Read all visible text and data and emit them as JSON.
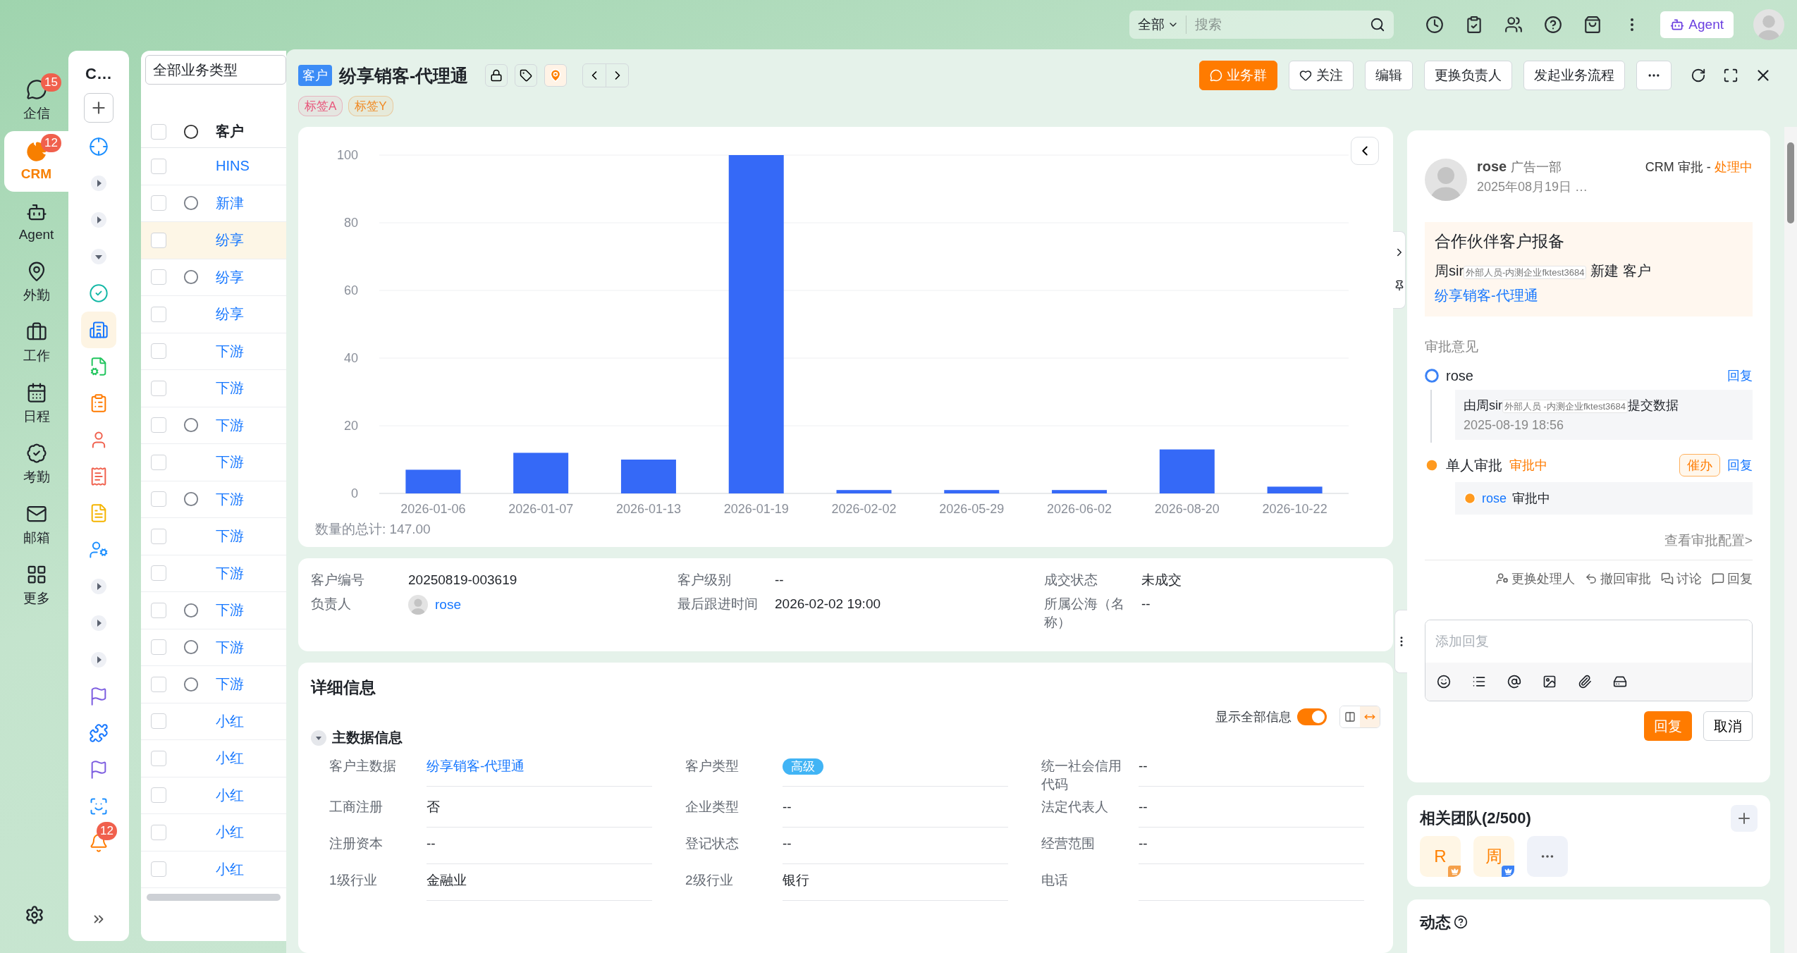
{
  "top_bar": {
    "scope": "全部",
    "search_placeholder": "搜索",
    "agent_label": "Agent"
  },
  "nav": [
    {
      "kind": "chat",
      "label": "企信",
      "badge": "15",
      "selected": false
    },
    {
      "kind": "crm",
      "label": "CRM",
      "badge": "12",
      "selected": true
    },
    {
      "kind": "agent",
      "label": "Agent",
      "selected": false
    },
    {
      "kind": "location",
      "label": "外勤",
      "selected": false
    },
    {
      "kind": "work",
      "label": "工作",
      "selected": false
    },
    {
      "kind": "calendar",
      "label": "日程",
      "selected": false
    },
    {
      "kind": "attendance",
      "label": "考勤",
      "selected": false
    },
    {
      "kind": "mail",
      "label": "邮箱",
      "selected": false
    },
    {
      "kind": "more",
      "label": "更多",
      "selected": false
    }
  ],
  "sub_nav": {
    "title": "C…",
    "items": [
      {
        "kind": "target",
        "selected": false
      },
      {
        "kind": "caret-right",
        "selected": false
      },
      {
        "kind": "caret-right",
        "selected": false
      },
      {
        "kind": "caret-down",
        "selected": false
      },
      {
        "kind": "check",
        "selected": false
      },
      {
        "kind": "building",
        "selected": true
      },
      {
        "kind": "doc-gear",
        "selected": false
      },
      {
        "kind": "clipboard",
        "selected": false
      },
      {
        "kind": "person",
        "selected": false
      },
      {
        "kind": "receipt",
        "selected": false
      },
      {
        "kind": "doc",
        "selected": false
      },
      {
        "kind": "user-gear",
        "selected": false
      },
      {
        "kind": "caret-right",
        "selected": false
      },
      {
        "kind": "caret-right",
        "selected": false
      },
      {
        "kind": "caret-right",
        "selected": false
      },
      {
        "kind": "flag",
        "selected": false
      },
      {
        "kind": "puzzle",
        "selected": false
      },
      {
        "kind": "flag",
        "selected": false
      },
      {
        "kind": "scan",
        "selected": false
      },
      {
        "kind": "bell",
        "badge": "12",
        "selected": false
      }
    ]
  },
  "list": {
    "type_filter": "全部业务类型",
    "column": "客户",
    "all_checked": false,
    "rows": [
      {
        "name": "HINS",
        "marked": false,
        "checked": false,
        "selected": false
      },
      {
        "name": "新津",
        "marked": true,
        "checked": false,
        "selected": false
      },
      {
        "name": "纷享",
        "marked": false,
        "checked": false,
        "selected": true
      },
      {
        "name": "纷享",
        "marked": true,
        "checked": false,
        "selected": false
      },
      {
        "name": "纷享",
        "marked": false,
        "checked": false,
        "selected": false
      },
      {
        "name": "下游",
        "marked": false,
        "checked": false,
        "selected": false
      },
      {
        "name": "下游",
        "marked": false,
        "checked": false,
        "selected": false
      },
      {
        "name": "下游",
        "marked": true,
        "checked": false,
        "selected": false
      },
      {
        "name": "下游",
        "marked": false,
        "checked": false,
        "selected": false
      },
      {
        "name": "下游",
        "marked": true,
        "checked": false,
        "selected": false
      },
      {
        "name": "下游",
        "marked": false,
        "checked": false,
        "selected": false
      },
      {
        "name": "下游",
        "marked": false,
        "checked": false,
        "selected": false
      },
      {
        "name": "下游",
        "marked": true,
        "checked": false,
        "selected": false
      },
      {
        "name": "下游",
        "marked": true,
        "checked": false,
        "selected": false
      },
      {
        "name": "下游",
        "marked": true,
        "checked": false,
        "selected": false
      },
      {
        "name": "小红",
        "marked": false,
        "checked": false,
        "selected": false
      },
      {
        "name": "小红",
        "marked": false,
        "checked": false,
        "selected": false
      },
      {
        "name": "小红",
        "marked": false,
        "checked": false,
        "selected": false
      },
      {
        "name": "小红",
        "marked": false,
        "checked": false,
        "selected": false
      },
      {
        "name": "小红",
        "marked": false,
        "checked": false,
        "selected": false
      }
    ]
  },
  "detail": {
    "type_tag": "客户",
    "title": "纷享销客-代理通",
    "tags": [
      {
        "label": "标签A",
        "color": "#e8557a"
      },
      {
        "label": "标签Y",
        "color": "#f08a24"
      }
    ],
    "actions": [
      {
        "kind": "primary",
        "label": "业务群"
      },
      {
        "kind": "follow",
        "label": "关注"
      },
      {
        "kind": "plain",
        "label": "编辑"
      },
      {
        "kind": "plain",
        "label": "更换负责人"
      },
      {
        "kind": "plain",
        "label": "发起业务流程"
      }
    ]
  },
  "chart": {
    "total": "数量的总计: 147.00",
    "chart_data": {
      "type": "bar",
      "categories": [
        "2026-01-06",
        "2026-01-07",
        "2026-01-13",
        "2026-01-19",
        "2026-02-02",
        "2026-05-29",
        "2026-06-02",
        "2026-08-20",
        "2026-10-22"
      ],
      "values": [
        7,
        12,
        10,
        100,
        1,
        1,
        1,
        13,
        2
      ],
      "ylim": [
        0,
        100
      ],
      "yticks": [
        0,
        20,
        40,
        60,
        80,
        100
      ],
      "grid": true
    }
  },
  "summary": [
    {
      "label": "客户编号",
      "value": "20250819-003619",
      "kind": "text"
    },
    {
      "label": "客户级别",
      "value": "--",
      "kind": "text"
    },
    {
      "label": "成交状态",
      "value": "未成交",
      "kind": "text"
    },
    {
      "label": "负责人",
      "value": "rose",
      "kind": "user"
    },
    {
      "label": "最后跟进时间",
      "value": "2026-02-02 19:00",
      "kind": "text"
    },
    {
      "label": "所属公海（名称）",
      "value": "--",
      "kind": "text"
    }
  ],
  "details": {
    "title": "详细信息",
    "show_all": {
      "label": "显示全部信息",
      "on": true
    },
    "section": {
      "title": "主数据信息",
      "expanded": true,
      "fields": [
        {
          "label": "客户主数据",
          "value": "纷享销客-代理通",
          "kind": "link"
        },
        {
          "label": "客户类型",
          "value": "高级",
          "kind": "badge"
        },
        {
          "label": "统一社会信用代码",
          "value": "--",
          "kind": "text"
        },
        {
          "label": "工商注册",
          "value": "否",
          "kind": "text"
        },
        {
          "label": "企业类型",
          "value": "--",
          "kind": "text"
        },
        {
          "label": "法定代表人",
          "value": "--",
          "kind": "text"
        },
        {
          "label": "注册资本",
          "value": "--",
          "kind": "text"
        },
        {
          "label": "登记状态",
          "value": "--",
          "kind": "text"
        },
        {
          "label": "经营范围",
          "value": "--",
          "kind": "text"
        },
        {
          "label": "1级行业",
          "value": "金融业",
          "kind": "text"
        },
        {
          "label": "2级行业",
          "value": "银行",
          "kind": "text"
        },
        {
          "label": "电话",
          "kind": "text"
        }
      ]
    }
  },
  "approval": {
    "user": "rose",
    "dept": "广告一部",
    "time": "2025年08月19日 …",
    "flow": "CRM 审批 - ",
    "status": "处理中",
    "title": "合作伙伴客户报备",
    "actor": "周sir",
    "actor_tag": "外部人员-内测企业fktest3684",
    "action": "新建 客户",
    "link": "纷享销客-代理通",
    "opinions_title": "审批意见",
    "steps": [
      {
        "kind": "done",
        "name": "rose",
        "reply": "回复",
        "note": {
          "prefix": "由周sir",
          "tag": "外部人员 -内测企业fktest3684",
          "suffix": "提交数据",
          "time": "2025-08-19 18:56"
        }
      },
      {
        "kind": "pending",
        "name": "单人审批",
        "status": "审批中",
        "urge": "催办",
        "reply": "回复",
        "assignee": "rose",
        "assignee_status": "审批中"
      }
    ],
    "config_link": "查看审批配置>",
    "tools": [
      {
        "kind": "reassign",
        "label": "更换处理人"
      },
      {
        "kind": "withdraw",
        "label": "撤回审批"
      },
      {
        "kind": "discuss",
        "label": "讨论"
      },
      {
        "kind": "reply",
        "label": "回复"
      }
    ],
    "reply_placeholder": "添加回复",
    "submit": "回复",
    "cancel": "取消"
  },
  "team": {
    "title": "相关团队(2/500)",
    "members": [
      {
        "initial": "R",
        "color": "#f5a04a"
      },
      {
        "initial": "周",
        "color": "#3b82f6"
      }
    ]
  },
  "feed": {
    "title": "动态"
  }
}
